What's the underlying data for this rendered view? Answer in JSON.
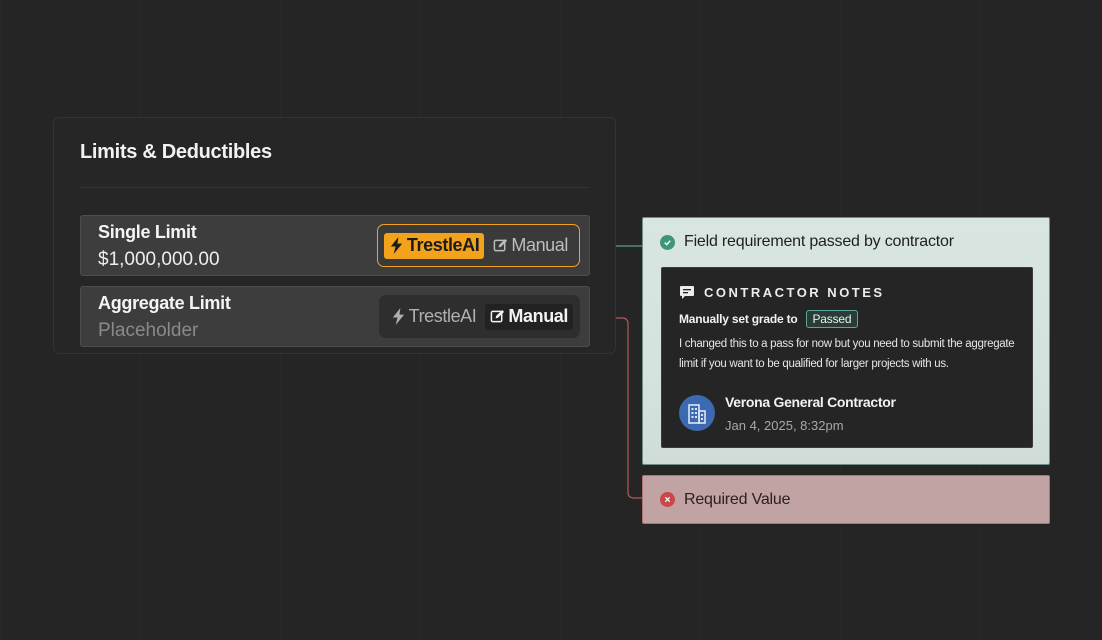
{
  "panel": {
    "title": "Limits & Deductibles",
    "fields": [
      {
        "label": "Single Limit",
        "value": "$1,000,000.00",
        "options": [
          "TrestleAI",
          "Manual"
        ],
        "selected": "TrestleAI"
      },
      {
        "label": "Aggregate Limit",
        "placeholder": "Placeholder",
        "options": [
          "TrestleAI",
          "Manual"
        ],
        "selected": "Manual"
      }
    ]
  },
  "pass_card": {
    "headline": "Field requirement passed by contractor",
    "notes_title": "CONTRACTOR NOTES",
    "grade_prefix": "Manually set grade to",
    "grade_value": "Passed",
    "note_text": "I changed this to a pass for now but you need to submit the aggregate limit if you want to be qualified for larger projects with us.",
    "author_name": "Verona General Contractor",
    "author_date": "Jan 4, 2025, 8:32pm"
  },
  "required_card": {
    "text": "Required Value"
  },
  "colors": {
    "accent_orange": "#f3a21b",
    "pass_green": "#3f9676",
    "fail_red": "#c94848",
    "avatar_blue": "#3c69b0"
  },
  "icons": [
    "bolt-icon",
    "edit-icon",
    "check-circle-icon",
    "chat-bubble-icon",
    "building-icon",
    "x-circle-icon"
  ]
}
